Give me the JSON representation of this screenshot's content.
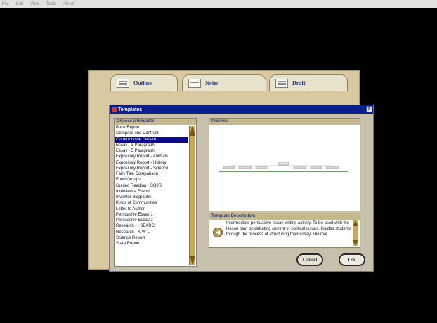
{
  "menubar": {
    "items": [
      "File",
      "Edit",
      "View",
      "Tools",
      "About"
    ]
  },
  "tabs": [
    {
      "label": "Outline",
      "icon": "outline-icon"
    },
    {
      "label": "Notes",
      "icon": "notes-icon"
    },
    {
      "label": "Draft",
      "icon": "draft-icon"
    }
  ],
  "dialog": {
    "title": "Templates",
    "close_label": "×",
    "list_header": "Choose a template:",
    "selected_template": "Current Issue Debate",
    "templates": [
      "Book Report",
      "Compare and Contrast",
      "Current Issue Debate",
      "Essay - 3 Paragraph",
      "Essay - 5 Paragraph",
      "Expository Report - Animals",
      "Expository Report - History",
      "Expository Report - Science",
      "Fairy Tale Comparison",
      "Food Groups",
      "Guided Reading - SQ3R",
      "Interview a Friend",
      "Inventor Biography",
      "Kinds of Communities",
      "Letter to Author",
      "Persuasive Essay 1",
      "Persuasive Essay 2",
      "Research - I SEARCH",
      "Research - K-W-L",
      "Science Report",
      "State Report"
    ],
    "preview_label": "Preview:",
    "description_label": "Template Description:",
    "description": "Intermediate persuasive essay writing activity. To be used with the lesson plan on debating current or political issues. Guides students through the process of structuring their essay. Minimal",
    "cancel_label": "Cancel",
    "ok_label": "OK"
  },
  "colors": {
    "titlebar": "#0b1e8e",
    "accent_gold": "#c8a85a",
    "selection": "#0a0a8a"
  }
}
